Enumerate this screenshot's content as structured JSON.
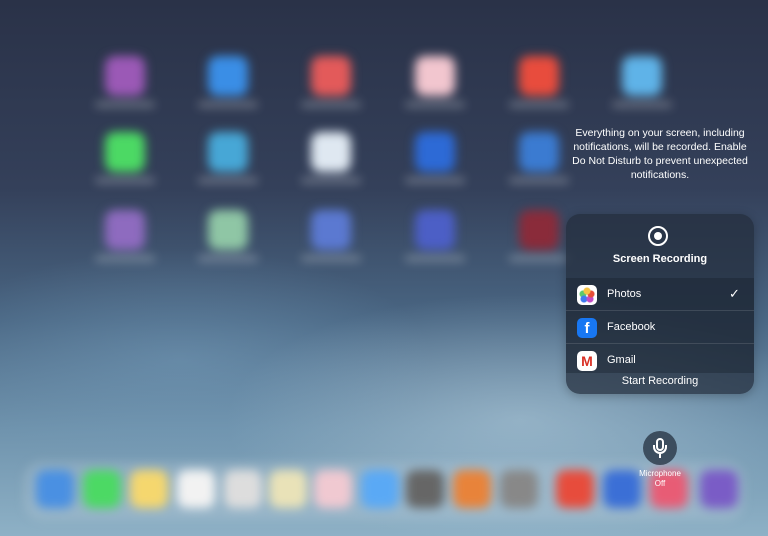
{
  "recording_info": "Everything on your screen, including notifications, will be recorded. Enable Do Not Disturb to prevent unexpected notifications.",
  "panel": {
    "title": "Screen Recording",
    "record_icon": "record-icon",
    "apps": [
      {
        "label": "Photos",
        "icon": "photos-icon",
        "selected": true
      },
      {
        "label": "Facebook",
        "icon": "facebook-icon",
        "selected": false
      },
      {
        "label": "Gmail",
        "icon": "gmail-icon",
        "selected": false
      }
    ],
    "check_glyph": "✓",
    "start_label": "Start Recording"
  },
  "microphone": {
    "icon": "microphone-icon",
    "label": "Microphone",
    "state": "Off"
  },
  "background": {
    "home_icon_colors": [
      "#9b59b6",
      "#3a8ee6",
      "#e35a5a",
      "#f2c6cf",
      "#e84c3d",
      "#5fb3e8",
      "#4cd964",
      "#47a7d6",
      "#dfe8f1",
      "#2d6ad6",
      "#3b7bd1",
      "#8e6bbf",
      "#8fc6a5",
      "#5b79d1",
      "#4c5fc6",
      "#8a2b3a"
    ],
    "dock_icon_colors": [
      "#4a90e2",
      "#4cd964",
      "#f5d76e",
      "#f2f2f2",
      "#dddddd",
      "#e9e2b8",
      "#f0c9d1",
      "#5aa9f5",
      "#666666",
      "#e8833a",
      "#888888",
      "#e74c3c",
      "#3b6fd6",
      "#e85c75",
      "#7a5cc6"
    ]
  }
}
